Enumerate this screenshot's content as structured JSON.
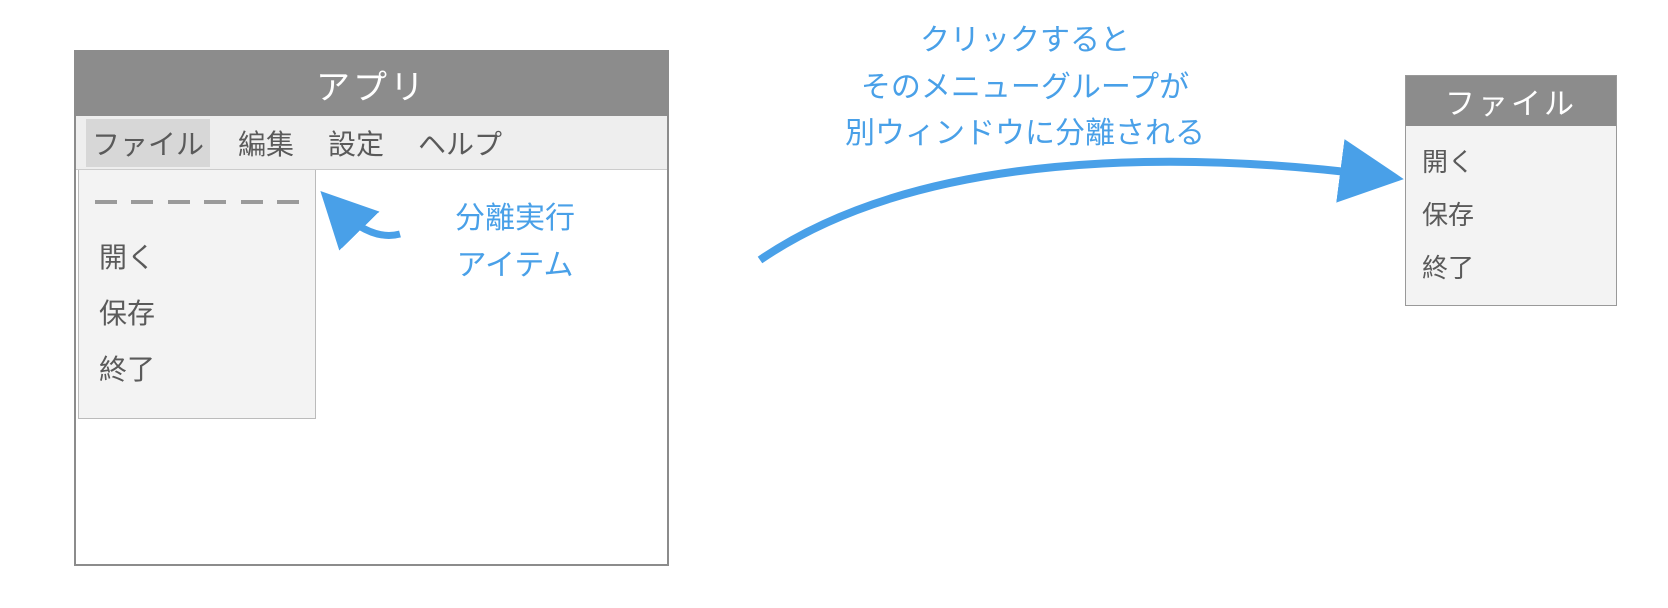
{
  "app": {
    "title": "アプリ",
    "menubar": {
      "file": "ファイル",
      "edit": "編集",
      "settings": "設定",
      "help": "ヘルプ"
    },
    "dropdown": {
      "options": {
        "open": "開く",
        "save": "保存",
        "exit": "終了"
      }
    }
  },
  "detached": {
    "title": "ファイル",
    "options": {
      "open": "開く",
      "save": "保存",
      "exit": "終了"
    }
  },
  "annotations": {
    "top_line1": "クリックすると",
    "top_line2": "そのメニューグループが",
    "top_line3": "別ウィンドウに分離される",
    "left_line1": "分離実行",
    "left_line2": "アイテム"
  },
  "colors": {
    "accent": "#49a0e8",
    "titlebar_bg": "#8c8c8c",
    "menubar_bg": "#eeeeee",
    "dropdown_bg": "#f3f3f3"
  }
}
